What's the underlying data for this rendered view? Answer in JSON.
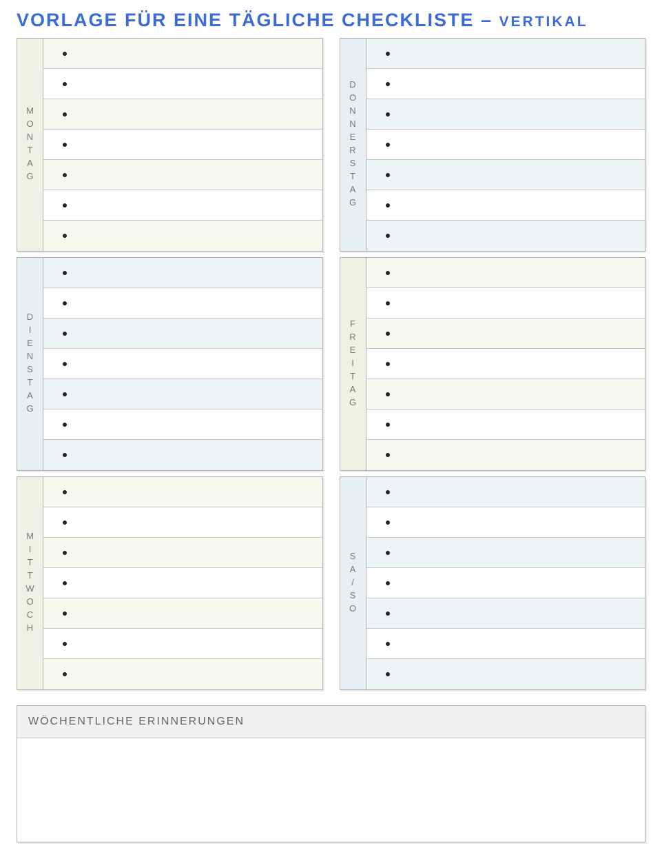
{
  "title_main": "VORLAGE FÜR EINE TÄGLICHE CHECKLISTE – ",
  "title_sub": "VERTIKAL",
  "left_days": [
    {
      "label": "MONTAG",
      "scheme": "a",
      "items": [
        "",
        "",
        "",
        "",
        "",
        "",
        ""
      ]
    },
    {
      "label": "DIENSTAG",
      "scheme": "b",
      "items": [
        "",
        "",
        "",
        "",
        "",
        "",
        ""
      ]
    },
    {
      "label": "MITTWOCH",
      "scheme": "a",
      "items": [
        "",
        "",
        "",
        "",
        "",
        "",
        ""
      ]
    }
  ],
  "right_days": [
    {
      "label": "DONNERSTAG",
      "scheme": "b",
      "items": [
        "",
        "",
        "",
        "",
        "",
        "",
        ""
      ]
    },
    {
      "label": "FREITAG",
      "scheme": "a",
      "items": [
        "",
        "",
        "",
        "",
        "",
        "",
        ""
      ]
    },
    {
      "label": "SA/SO",
      "scheme": "b",
      "items": [
        "",
        "",
        "",
        "",
        "",
        "",
        ""
      ]
    }
  ],
  "reminders_header": "WÖCHENTLICHE ERINNERUNGEN",
  "reminders_body": ""
}
